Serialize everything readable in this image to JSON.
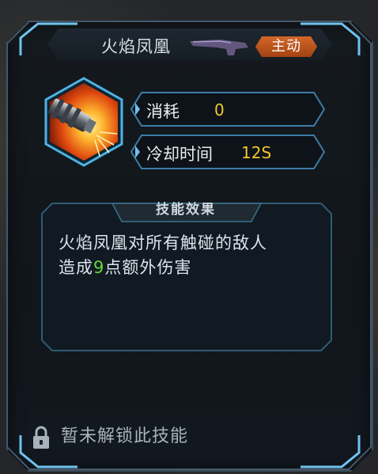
{
  "skill": {
    "name": "火焰凤凰",
    "type_badge": "主动",
    "icon": "flame-cannon-icon",
    "weapon_icon": "shotgun-icon"
  },
  "stats": {
    "cost_label": "消耗",
    "cost_value": "0",
    "cooldown_label": "冷却时间",
    "cooldown_value": "12S"
  },
  "effect": {
    "tab_label": "技能效果",
    "line1": "火焰凤凰对所有触碰的敌人",
    "line2_prefix": "造成",
    "line2_number": "9",
    "line2_suffix": "点额外伤害"
  },
  "lock": {
    "icon": "lock-icon",
    "text": "暂未解锁此技能"
  },
  "colors": {
    "accent_blue": "#4f8fb8",
    "value_yellow": "#f2c62c",
    "highlight_green": "#5fdb3d",
    "badge_orange": "#c85a20"
  }
}
